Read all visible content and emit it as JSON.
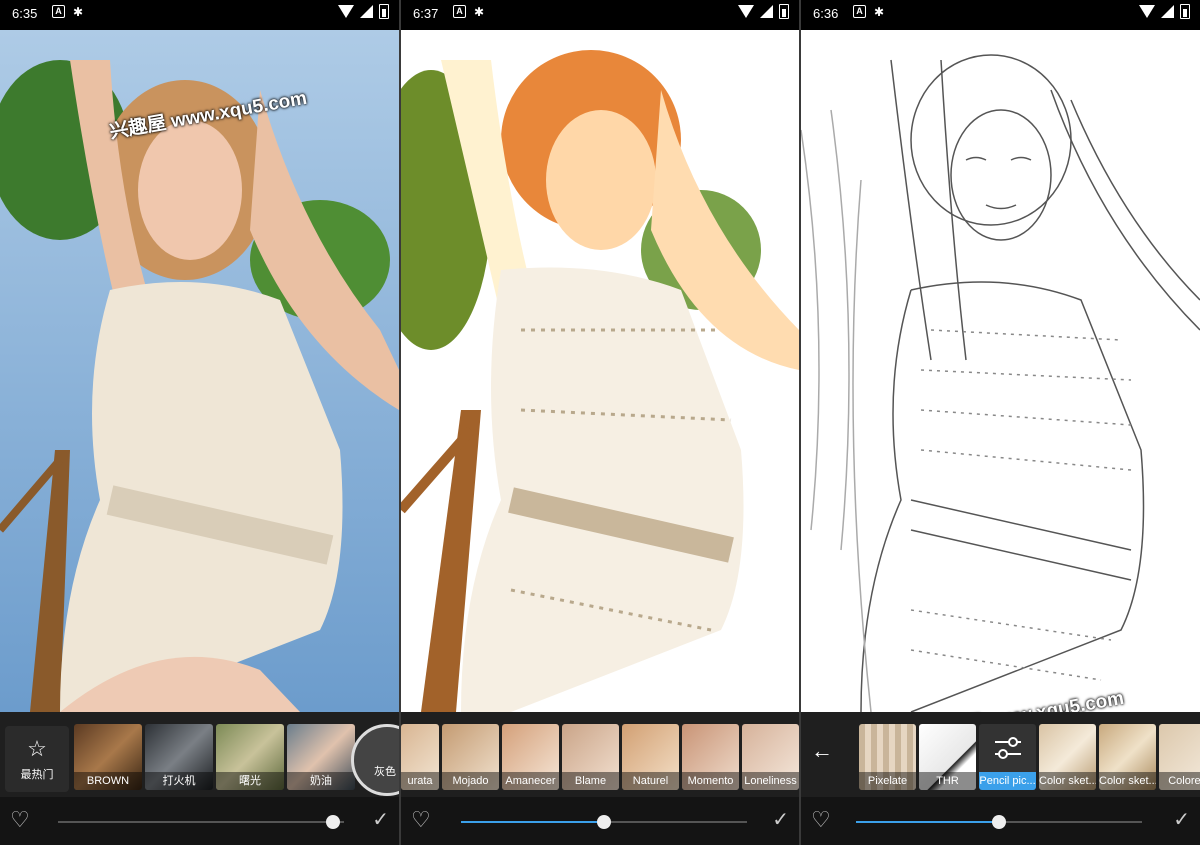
{
  "watermark_text": "兴趣屋 www.xqu5.com",
  "colors": {
    "accent": "#3ba0ea",
    "filter_bar": "#1f1f1f"
  },
  "panels": [
    {
      "time": "6:35",
      "status_icons": [
        "a-icon",
        "gear-icon",
        "wifi-icon",
        "signal-icon",
        "battery-icon"
      ],
      "hot_label": "最热门",
      "filters": [
        "BROWN",
        "打火机",
        "曙光",
        "奶油",
        "灰色"
      ],
      "slider_level": 0.96
    },
    {
      "time": "6:37",
      "status_icons": [
        "a-icon",
        "gear-icon",
        "wifi-icon",
        "signal-icon",
        "battery-icon"
      ],
      "filters": [
        "urata",
        "Mojado",
        "Amanecer",
        "Blame",
        "Naturel",
        "Momento",
        "Loneliness"
      ],
      "slider_level": 0.5
    },
    {
      "time": "6:36",
      "status_icons": [
        "a-icon",
        "gear-icon",
        "wifi-icon",
        "signal-icon",
        "battery-icon"
      ],
      "filters": [
        "Pixelate",
        "THR",
        "Pencil pic...",
        "Color sket...",
        "Color sket...",
        "Colored"
      ],
      "selected_filter": "Pencil pic...",
      "slider_level": 0.5
    }
  ]
}
